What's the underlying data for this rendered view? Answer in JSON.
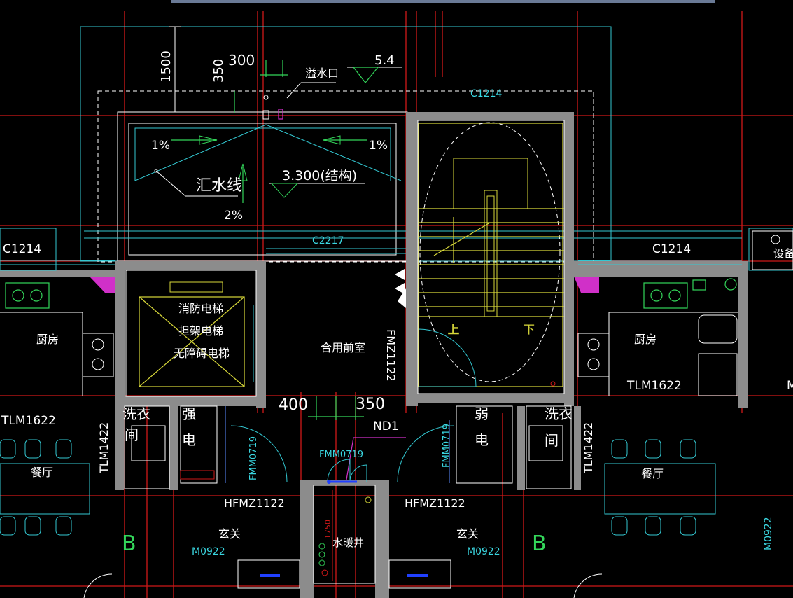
{
  "drawing": {
    "background": "#000000",
    "colors": {
      "grid_line": "#d01818",
      "wall": "#8c8c8c",
      "text": "#ffffff",
      "cyan": "#33c8d2",
      "yellow": "#d8d83a",
      "green": "#33d65a",
      "magenta": "#d030c8",
      "blue": "#5a8aff"
    },
    "roof": {
      "dim_1500": "1500",
      "dim_350": "350",
      "dim_300": "300",
      "overflow_label": "溢水口",
      "elevation_top": "5.4",
      "window_top": "C1214",
      "slope_left": "1%",
      "slope_right": "1%",
      "slope_down": "2%",
      "drain_line": "汇水线",
      "elevation_structure": "3.300(结构)",
      "window_front": "C2217"
    },
    "windows": {
      "left": "C1214",
      "right": "C1214"
    },
    "elevator": {
      "line1": "消防电梯",
      "line2": "担架电梯",
      "line3": "无障碍电梯"
    },
    "lobby": {
      "label": "合用前室",
      "door_vertical": "FMZ1122",
      "dim_400": "400",
      "dim_350": "350",
      "nd_label": "ND1",
      "door_center": "FMM0719"
    },
    "stair": {
      "up": "上",
      "down": "下"
    },
    "kitchen_left": {
      "label": "厨房",
      "door": "TLM1622"
    },
    "kitchen_right": {
      "label": "厨房",
      "door": "TLM1622",
      "equipment": "设备"
    },
    "laundry_left": {
      "line1": "洗衣",
      "line2": "间"
    },
    "laundry_right": {
      "line1": "洗衣",
      "line2": "间"
    },
    "strong_elec": {
      "line1": "强",
      "line2": "电"
    },
    "weak_elec": {
      "line1": "弱",
      "line2": "电"
    },
    "doors": {
      "fm_left": "FMM0719",
      "fm_right": "FMM0719",
      "hfm_left": "HFMZ1122",
      "hfm_right": "HFMZ1122",
      "tlm_left_side": "TLM1422",
      "tlm_right_side": "TLM1422",
      "m_left": "M0922",
      "m_right": "M0922",
      "m_far_right": "M0922"
    },
    "dining_left": "餐厅",
    "dining_right": "餐厅",
    "foyer_left": "玄关",
    "foyer_right": "玄关",
    "axis_left": "B",
    "axis_right": "B",
    "shaft": {
      "label": "水暖井",
      "dim": "1750"
    },
    "edge_partial": "M"
  }
}
